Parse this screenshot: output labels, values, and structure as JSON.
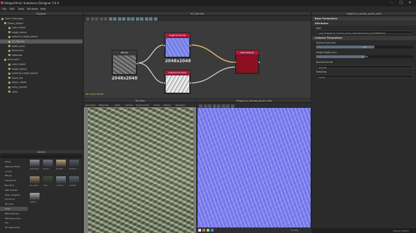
{
  "window": {
    "title": "Allegorithmic Substance Designer 5.6.0",
    "controls": [
      "–",
      "□",
      "×"
    ]
  },
  "menu": [
    "File",
    "Edit",
    "Tools",
    "Windows",
    "Help"
  ],
  "explorer": {
    "title": "Explorer",
    "tree": [
      {
        "label": "User's Packages",
        "icon": "package-icon",
        "selected": false
      },
      {
        "label": "Filters_9Kabr*",
        "icon": "package-icon",
        "selected": false
      },
      {
        "label": "color_match",
        "icon": "graph-icon",
        "selected": false
      },
      {
        "label": "height_blend",
        "icon": "graph-icon",
        "selected": false
      },
      {
        "label": "material_height_blend",
        "icon": "graph-icon",
        "selected": false
      },
      {
        "label": "AO_Normal",
        "icon": "graph-icon",
        "selected": true
      },
      {
        "label": "water_level",
        "icon": "graph-icon",
        "selected": false
      },
      {
        "label": "Resources",
        "icon": "folder-icon",
        "selected": false
      },
      {
        "label": "Materials",
        "icon": "folder-icon",
        "selected": false
      },
      {
        "label": "rocks.sbs*",
        "icon": "package-icon",
        "selected": false
      },
      {
        "label": "color_match",
        "icon": "graph-icon",
        "selected": false
      },
      {
        "label": "height_blend",
        "icon": "graph-icon",
        "selected": false
      },
      {
        "label": "material_height_blend",
        "icon": "graph-icon",
        "selected": false
      },
      {
        "label": "stone_tile",
        "icon": "graph-icon",
        "selected": false
      },
      {
        "label": "stone_create",
        "icon": "graph-icon",
        "selected": false
      },
      {
        "label": "rocky_ground",
        "icon": "graph-icon",
        "selected": false
      },
      {
        "label": "roots",
        "icon": "graph-icon",
        "selected": false
      }
    ]
  },
  "graph": {
    "title": "AO_Normal",
    "nodes": [
      {
        "name": "Bitmap",
        "resolution": "2048x2048",
        "color": "#3b3b3b"
      },
      {
        "name": "Height To Normal",
        "resolution": "2048x2048",
        "color": "#b5173a"
      },
      {
        "name": "Ambient Occlusion",
        "resolution": "2048x2048",
        "color": "#b5173a"
      },
      {
        "name": "Base Material",
        "resolution": "",
        "color": "#b5173a"
      }
    ],
    "footer_note": "No output defined"
  },
  "params": {
    "title": "height_to_normal_world_units",
    "sections": {
      "base": "Base Parameters",
      "attributes": "Attributes",
      "instance": "Instance Parameters"
    },
    "fields": [
      {
        "label": "Path",
        "value": "pkg:///height_to_normal_world_units?dependency=1073661212"
      },
      {
        "label": "Surface Size (cm)",
        "value": "300"
      },
      {
        "label": "Height Depth (cm)",
        "value": "12.78"
      },
      {
        "label": "Normal Format",
        "value": "DirectX"
      },
      {
        "label": "Sampling",
        "value": "Linear"
      }
    ],
    "sliders": [
      {
        "label": "Surface Size (cm)",
        "value": "300",
        "fill": 0.6
      },
      {
        "label": "Height Depth (cm)",
        "value": "12.78",
        "fill": 0.5
      }
    ]
  },
  "library": {
    "title": "Library",
    "categories": [
      {
        "label": "Filters",
        "selected": false
      },
      {
        "label": "Material Filters",
        "selected": false
      },
      {
        "label": "1-Click",
        "selected": false
      },
      {
        "label": "Effects",
        "selected": false
      },
      {
        "label": "Transforms",
        "selected": false
      },
      {
        "label": "Blending",
        "selected": false
      },
      {
        "label": "PBR Utilities",
        "selected": false
      },
      {
        "label": "Mesh Adaptive",
        "selected": false
      },
      {
        "label": "Functions",
        "selected": false
      },
      {
        "label": "3D View",
        "selected": false
      },
      {
        "label": "HDRI",
        "selected": true
      },
      {
        "label": "PBR Materials",
        "selected": false
      },
      {
        "label": "MDL Resources",
        "selected": false
      },
      {
        "label": "sbs",
        "selected": false
      },
      {
        "label": "3D Maps Stuff",
        "selected": false
      }
    ],
    "thumbs": [
      {
        "caption": "alexandra..."
      },
      {
        "caption": "airport"
      },
      {
        "caption": "bonifaci..."
      },
      {
        "caption": "Bonifaci..."
      },
      {
        "caption": "bus_gara..."
      },
      {
        "caption": "cave_..."
      },
      {
        "caption": "corridor_..."
      },
      {
        "caption": "escalat..."
      },
      {
        "caption": "Gilbert_..."
      }
    ]
  },
  "view3d": {
    "title": "3D View",
    "menu": [
      "Geometry",
      "Materials",
      "Lights",
      "Camera",
      "Environment",
      "Scene",
      "Display",
      "Renderer"
    ]
  },
  "view2d": {
    "title": "Height_to_normal_world_units",
    "zoom": "11.00%"
  },
  "status": {
    "text": "Engine: D3D11"
  }
}
